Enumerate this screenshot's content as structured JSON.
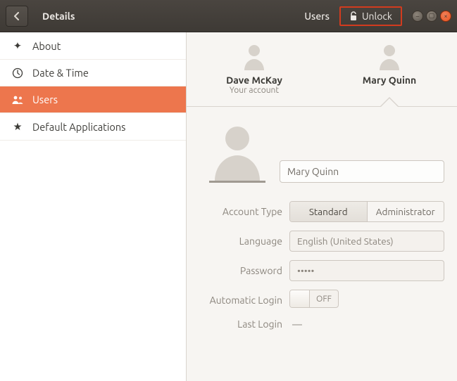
{
  "header": {
    "title": "Details",
    "users_btn": "Users",
    "unlock_btn": "Unlock"
  },
  "sidebar": {
    "items": [
      {
        "label": "About"
      },
      {
        "label": "Date & Time"
      },
      {
        "label": "Users"
      },
      {
        "label": "Default Applications"
      }
    ]
  },
  "users": [
    {
      "name": "Dave McKay",
      "subtitle": "Your account"
    },
    {
      "name": "Mary Quinn",
      "subtitle": ""
    }
  ],
  "form": {
    "full_name": "Mary Quinn",
    "account_type_label": "Account Type",
    "account_type_options": [
      "Standard",
      "Administrator"
    ],
    "language_label": "Language",
    "language_value": "English (United States)",
    "password_label": "Password",
    "password_mask": "•••••",
    "autologin_label": "Automatic Login",
    "autologin_value": "OFF",
    "lastlogin_label": "Last Login",
    "lastlogin_value": "—"
  }
}
